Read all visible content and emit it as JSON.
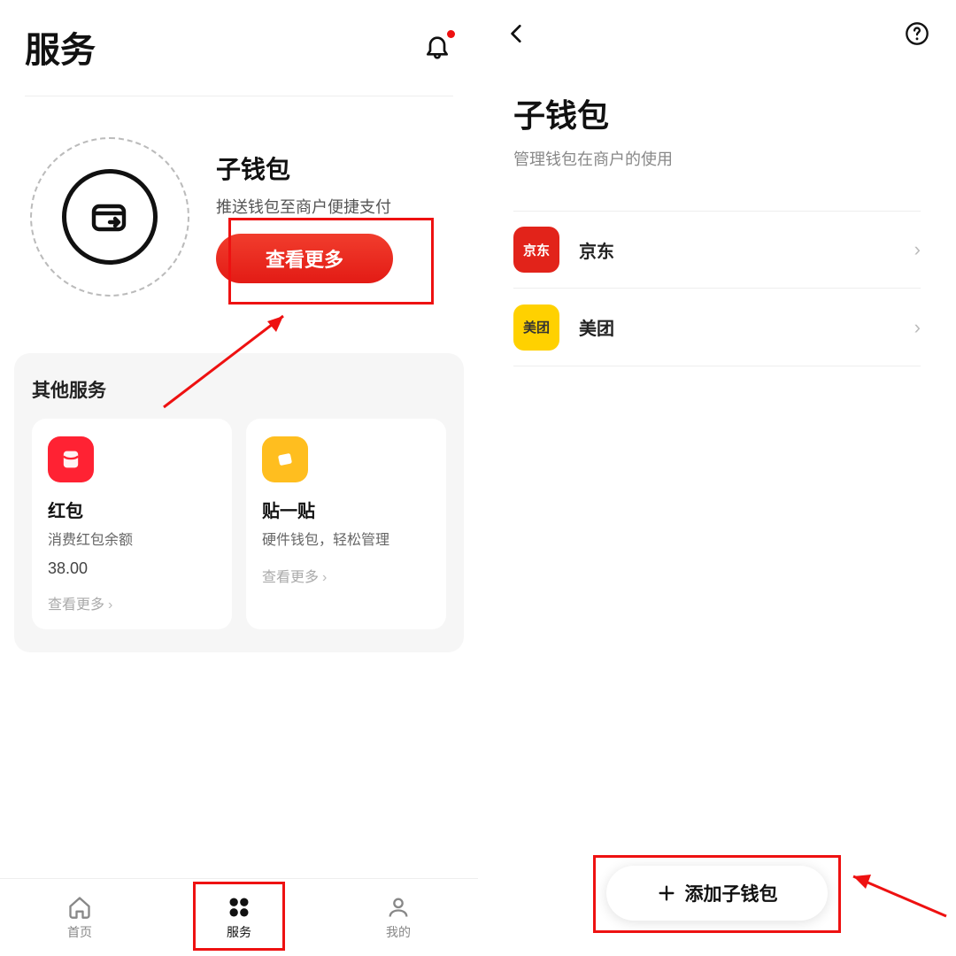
{
  "screen1": {
    "title": "服务",
    "subwallet": {
      "title": "子钱包",
      "subtitle": "推送钱包至商户便捷支付",
      "button": "查看更多"
    },
    "other_title": "其他服务",
    "services": [
      {
        "name": "红包",
        "sub": "消费红包余额",
        "amount": "38.00",
        "more": "查看更多"
      },
      {
        "name": "贴一贴",
        "sub": "硬件钱包，轻松管理",
        "more": "查看更多"
      }
    ],
    "tabs": [
      {
        "label": "首页"
      },
      {
        "label": "服务"
      },
      {
        "label": "我的"
      }
    ]
  },
  "screen2": {
    "title": "子钱包",
    "subtitle": "管理钱包在商户的使用",
    "merchants": [
      {
        "name": "京东",
        "logo_text": "京东"
      },
      {
        "name": "美团",
        "logo_text": "美团"
      }
    ],
    "add_button": "添加子钱包"
  }
}
